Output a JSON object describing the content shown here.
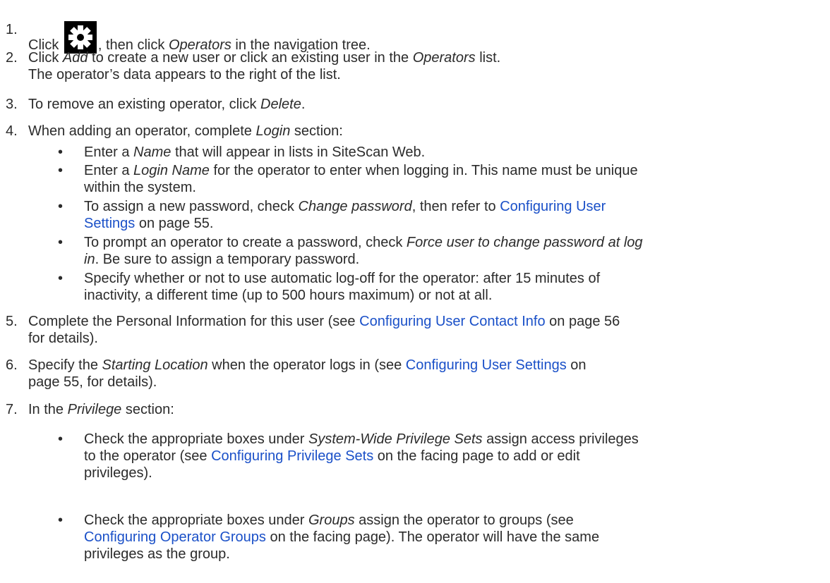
{
  "steps": [
    {
      "num": "1.",
      "parts": [
        {
          "t": "Click "
        },
        {
          "icon": "gear-icon"
        },
        {
          "t": ", then click "
        },
        {
          "t": "Operators",
          "em": true
        },
        {
          "t": " in the navigation tree."
        }
      ]
    },
    {
      "num": "2.",
      "parts": [
        {
          "t": "Click "
        },
        {
          "t": "Add",
          "em": true
        },
        {
          "t": " to create a new user or click an existing user in the "
        },
        {
          "t": "Operators",
          "em": true
        },
        {
          "t": " list."
        },
        {
          "br": true
        },
        {
          "t": "The operator’s data appears to the right of the list."
        }
      ]
    },
    {
      "num": "3.",
      "parts": [
        {
          "t": "To remove an existing operator, click "
        },
        {
          "t": "Delete",
          "em": true
        },
        {
          "t": "."
        }
      ]
    },
    {
      "num": "4.",
      "parts": [
        {
          "t": "When adding an operator, complete "
        },
        {
          "t": "Login",
          "em": true
        },
        {
          "t": " section:"
        }
      ]
    },
    {
      "num": "5.",
      "parts": [
        {
          "t": "Complete the Personal Information for this user (see "
        },
        {
          "t": "Configuring User Contact Info",
          "link": true
        },
        {
          "t": " on page 56"
        },
        {
          "br": true
        },
        {
          "t": "for details)."
        }
      ]
    },
    {
      "num": "6.",
      "parts": [
        {
          "t": "Specify the "
        },
        {
          "t": "Starting Location",
          "em": true
        },
        {
          "t": " when the operator logs in (see "
        },
        {
          "t": "Configuring User Settings",
          "link": true
        },
        {
          "t": " on"
        },
        {
          "br": true
        },
        {
          "t": "page 55, for details)."
        }
      ]
    },
    {
      "num": "7.",
      "parts": [
        {
          "t": "In the "
        },
        {
          "t": "Privilege",
          "em": true
        },
        {
          "t": " section:"
        }
      ]
    }
  ],
  "login_bullets": [
    {
      "dot": "•",
      "parts": [
        {
          "t": "Enter a "
        },
        {
          "t": "Name",
          "em": true
        },
        {
          "t": " that will appear in lists in SiteScan Web."
        }
      ]
    },
    {
      "dot": "•",
      "parts": [
        {
          "t": "Enter a "
        },
        {
          "t": "Login Name",
          "em": true
        },
        {
          "t": " for the operator to enter when logging in. This name must be unique"
        },
        {
          "br": true
        },
        {
          "t": "within the system."
        }
      ]
    },
    {
      "dot": "•",
      "parts": [
        {
          "t": "To assign a new password, check "
        },
        {
          "t": "Change password",
          "em": true
        },
        {
          "t": ", then refer to "
        },
        {
          "t": "Configuring User",
          "link": true
        },
        {
          "br": true
        },
        {
          "t": "Settings",
          "link": true
        },
        {
          "t": " on page 55."
        }
      ]
    },
    {
      "dot": "•",
      "parts": [
        {
          "t": "To prompt an operator to create a password, check "
        },
        {
          "t": "Force user to change password at log",
          "em": true
        },
        {
          "br": true
        },
        {
          "t": "in",
          "em": true
        },
        {
          "t": ". Be sure to assign a temporary password."
        }
      ]
    },
    {
      "dot": "•",
      "parts": [
        {
          "t": "Specify whether or not to use automatic log-off for the operator: after 15 minutes of"
        },
        {
          "br": true
        },
        {
          "t": "inactivity, a different time (up to 500 hours maximum) or not at all."
        }
      ]
    }
  ],
  "privilege_bullets": [
    {
      "dot": "•",
      "parts": [
        {
          "t": "Check the appropriate boxes under "
        },
        {
          "t": "System-Wide Privilege Sets",
          "em": true
        },
        {
          "t": " assign access privileges"
        },
        {
          "br": true
        },
        {
          "t": "to the operator (see "
        },
        {
          "t": "Configuring Privilege Sets",
          "link": true
        },
        {
          "t": " on the facing page to add or edit"
        },
        {
          "br": true
        },
        {
          "t": "privileges)."
        }
      ]
    },
    {
      "dot": "•",
      "parts": [
        {
          "t": "Check the appropriate boxes under "
        },
        {
          "t": "Groups",
          "em": true
        },
        {
          "t": " assign the operator to groups (see"
        },
        {
          "br": true
        },
        {
          "t": "Configuring Operator Groups",
          "link": true
        },
        {
          "t": " on the facing page). The operator will have the same"
        },
        {
          "br": true
        },
        {
          "t": "privileges as the group."
        }
      ]
    }
  ]
}
